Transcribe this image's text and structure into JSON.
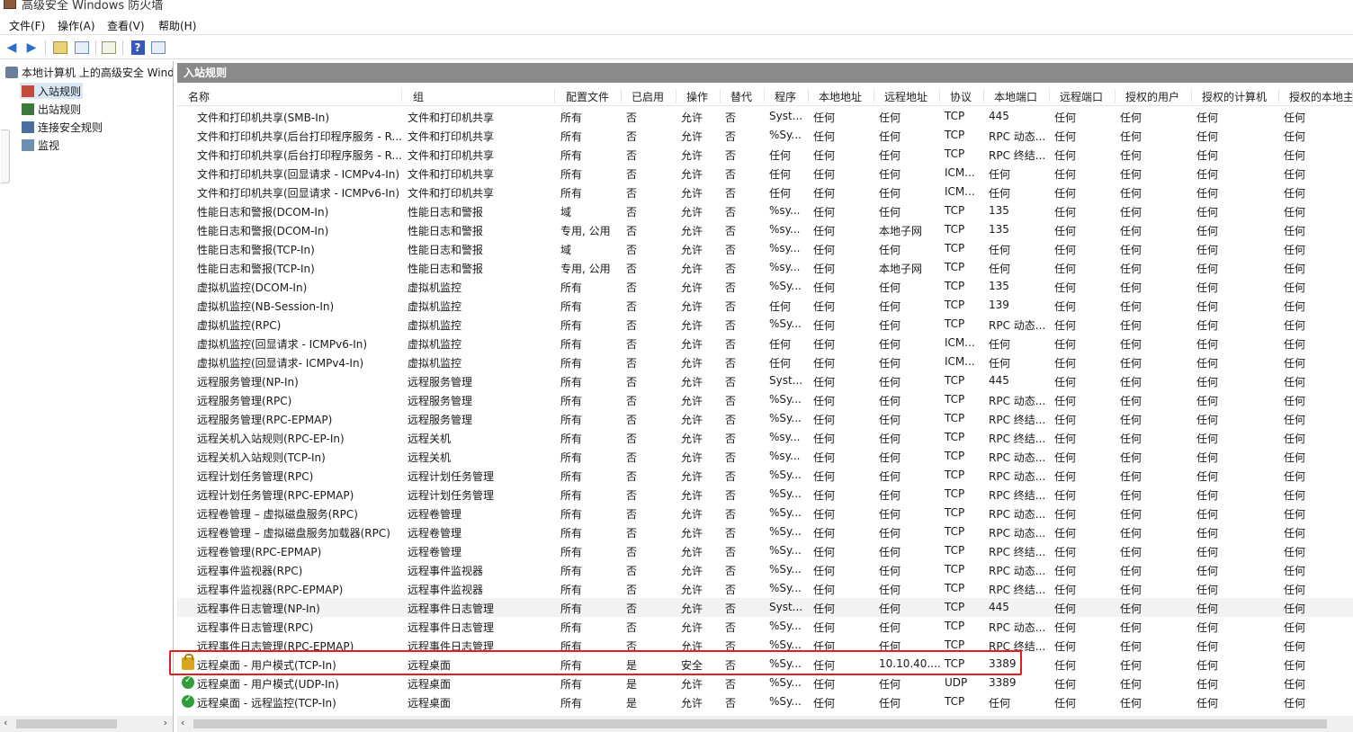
{
  "window": {
    "title": "高级安全 Windows 防火墙"
  },
  "menu": [
    "文件(F)",
    "操作(A)",
    "查看(V)",
    "帮助(H)"
  ],
  "toolbar": {
    "help_label": "?"
  },
  "tree": {
    "root": "本地计算机 上的高级安全 Windows 防火墙",
    "items": [
      "入站规则",
      "出站规则",
      "连接安全规则",
      "监视"
    ]
  },
  "pane": {
    "title": "入站规则"
  },
  "columns": [
    "名称",
    "组",
    "配置文件",
    "已启用",
    "操作",
    "替代",
    "程序",
    "本地地址",
    "远程地址",
    "协议",
    "本地端口",
    "远程端口",
    "授权的用户",
    "授权的计算机",
    "授权的本地主体"
  ],
  "rows": [
    {
      "status": "",
      "cells": [
        "文件和打印机共享(SMB-In)",
        "文件和打印机共享",
        "所有",
        "否",
        "允许",
        "否",
        "Syst...",
        "任何",
        "任何",
        "TCP",
        "445",
        "任何",
        "任何",
        "任何",
        "任何"
      ]
    },
    {
      "status": "",
      "cells": [
        "文件和打印机共享(后台打印程序服务 - R...",
        "文件和打印机共享",
        "所有",
        "否",
        "允许",
        "否",
        "%Sy...",
        "任何",
        "任何",
        "TCP",
        "RPC 动态...",
        "任何",
        "任何",
        "任何",
        "任何"
      ]
    },
    {
      "status": "",
      "cells": [
        "文件和打印机共享(后台打印程序服务 - R...",
        "文件和打印机共享",
        "所有",
        "否",
        "允许",
        "否",
        "任何",
        "任何",
        "任何",
        "TCP",
        "RPC 终结...",
        "任何",
        "任何",
        "任何",
        "任何"
      ]
    },
    {
      "status": "",
      "cells": [
        "文件和打印机共享(回显请求 - ICMPv4-In)",
        "文件和打印机共享",
        "所有",
        "否",
        "允许",
        "否",
        "任何",
        "任何",
        "任何",
        "ICM...",
        "任何",
        "任何",
        "任何",
        "任何",
        "任何"
      ]
    },
    {
      "status": "",
      "cells": [
        "文件和打印机共享(回显请求 - ICMPv6-In)",
        "文件和打印机共享",
        "所有",
        "否",
        "允许",
        "否",
        "任何",
        "任何",
        "任何",
        "ICM...",
        "任何",
        "任何",
        "任何",
        "任何",
        "任何"
      ]
    },
    {
      "status": "",
      "cells": [
        "性能日志和警报(DCOM-In)",
        "性能日志和警报",
        "域",
        "否",
        "允许",
        "否",
        "%sy...",
        "任何",
        "任何",
        "TCP",
        "135",
        "任何",
        "任何",
        "任何",
        "任何"
      ]
    },
    {
      "status": "",
      "cells": [
        "性能日志和警报(DCOM-In)",
        "性能日志和警报",
        "专用, 公用",
        "否",
        "允许",
        "否",
        "%sy...",
        "任何",
        "本地子网",
        "TCP",
        "135",
        "任何",
        "任何",
        "任何",
        "任何"
      ]
    },
    {
      "status": "",
      "cells": [
        "性能日志和警报(TCP-In)",
        "性能日志和警报",
        "域",
        "否",
        "允许",
        "否",
        "%sy...",
        "任何",
        "任何",
        "TCP",
        "任何",
        "任何",
        "任何",
        "任何",
        "任何"
      ]
    },
    {
      "status": "",
      "cells": [
        "性能日志和警报(TCP-In)",
        "性能日志和警报",
        "专用, 公用",
        "否",
        "允许",
        "否",
        "%sy...",
        "任何",
        "本地子网",
        "TCP",
        "任何",
        "任何",
        "任何",
        "任何",
        "任何"
      ]
    },
    {
      "status": "",
      "cells": [
        "虚拟机监控(DCOM-In)",
        "虚拟机监控",
        "所有",
        "否",
        "允许",
        "否",
        "%Sy...",
        "任何",
        "任何",
        "TCP",
        "135",
        "任何",
        "任何",
        "任何",
        "任何"
      ]
    },
    {
      "status": "",
      "cells": [
        "虚拟机监控(NB-Session-In)",
        "虚拟机监控",
        "所有",
        "否",
        "允许",
        "否",
        "任何",
        "任何",
        "任何",
        "TCP",
        "139",
        "任何",
        "任何",
        "任何",
        "任何"
      ]
    },
    {
      "status": "",
      "cells": [
        "虚拟机监控(RPC)",
        "虚拟机监控",
        "所有",
        "否",
        "允许",
        "否",
        "%Sy...",
        "任何",
        "任何",
        "TCP",
        "RPC 动态...",
        "任何",
        "任何",
        "任何",
        "任何"
      ]
    },
    {
      "status": "",
      "cells": [
        "虚拟机监控(回显请求 - ICMPv6-In)",
        "虚拟机监控",
        "所有",
        "否",
        "允许",
        "否",
        "任何",
        "任何",
        "任何",
        "ICM...",
        "任何",
        "任何",
        "任何",
        "任何",
        "任何"
      ]
    },
    {
      "status": "",
      "cells": [
        "虚拟机监控(回显请求- ICMPv4-In)",
        "虚拟机监控",
        "所有",
        "否",
        "允许",
        "否",
        "任何",
        "任何",
        "任何",
        "ICM...",
        "任何",
        "任何",
        "任何",
        "任何",
        "任何"
      ]
    },
    {
      "status": "",
      "cells": [
        "远程服务管理(NP-In)",
        "远程服务管理",
        "所有",
        "否",
        "允许",
        "否",
        "Syst...",
        "任何",
        "任何",
        "TCP",
        "445",
        "任何",
        "任何",
        "任何",
        "任何"
      ]
    },
    {
      "status": "",
      "cells": [
        "远程服务管理(RPC)",
        "远程服务管理",
        "所有",
        "否",
        "允许",
        "否",
        "%Sy...",
        "任何",
        "任何",
        "TCP",
        "RPC 动态...",
        "任何",
        "任何",
        "任何",
        "任何"
      ]
    },
    {
      "status": "",
      "cells": [
        "远程服务管理(RPC-EPMAP)",
        "远程服务管理",
        "所有",
        "否",
        "允许",
        "否",
        "%Sy...",
        "任何",
        "任何",
        "TCP",
        "RPC 终结...",
        "任何",
        "任何",
        "任何",
        "任何"
      ]
    },
    {
      "status": "",
      "cells": [
        "远程关机入站规则(RPC-EP-In)",
        "远程关机",
        "所有",
        "否",
        "允许",
        "否",
        "%sy...",
        "任何",
        "任何",
        "TCP",
        "RPC 终结...",
        "任何",
        "任何",
        "任何",
        "任何"
      ]
    },
    {
      "status": "",
      "cells": [
        "远程关机入站规则(TCP-In)",
        "远程关机",
        "所有",
        "否",
        "允许",
        "否",
        "%sy...",
        "任何",
        "任何",
        "TCP",
        "RPC 动态...",
        "任何",
        "任何",
        "任何",
        "任何"
      ]
    },
    {
      "status": "",
      "cells": [
        "远程计划任务管理(RPC)",
        "远程计划任务管理",
        "所有",
        "否",
        "允许",
        "否",
        "%Sy...",
        "任何",
        "任何",
        "TCP",
        "RPC 动态...",
        "任何",
        "任何",
        "任何",
        "任何"
      ]
    },
    {
      "status": "",
      "cells": [
        "远程计划任务管理(RPC-EPMAP)",
        "远程计划任务管理",
        "所有",
        "否",
        "允许",
        "否",
        "%Sy...",
        "任何",
        "任何",
        "TCP",
        "RPC 终结...",
        "任何",
        "任何",
        "任何",
        "任何"
      ]
    },
    {
      "status": "",
      "cells": [
        "远程卷管理 – 虚拟磁盘服务(RPC)",
        "远程卷管理",
        "所有",
        "否",
        "允许",
        "否",
        "%Sy...",
        "任何",
        "任何",
        "TCP",
        "RPC 动态...",
        "任何",
        "任何",
        "任何",
        "任何"
      ]
    },
    {
      "status": "",
      "cells": [
        "远程卷管理 – 虚拟磁盘服务加载器(RPC)",
        "远程卷管理",
        "所有",
        "否",
        "允许",
        "否",
        "%Sy...",
        "任何",
        "任何",
        "TCP",
        "RPC 动态...",
        "任何",
        "任何",
        "任何",
        "任何"
      ]
    },
    {
      "status": "",
      "cells": [
        "远程卷管理(RPC-EPMAP)",
        "远程卷管理",
        "所有",
        "否",
        "允许",
        "否",
        "%Sy...",
        "任何",
        "任何",
        "TCP",
        "RPC 终结...",
        "任何",
        "任何",
        "任何",
        "任何"
      ]
    },
    {
      "status": "",
      "cells": [
        "远程事件监视器(RPC)",
        "远程事件监视器",
        "所有",
        "否",
        "允许",
        "否",
        "%Sy...",
        "任何",
        "任何",
        "TCP",
        "RPC 动态...",
        "任何",
        "任何",
        "任何",
        "任何"
      ]
    },
    {
      "status": "",
      "cells": [
        "远程事件监视器(RPC-EPMAP)",
        "远程事件监视器",
        "所有",
        "否",
        "允许",
        "否",
        "%Sy...",
        "任何",
        "任何",
        "TCP",
        "RPC 终结...",
        "任何",
        "任何",
        "任何",
        "任何"
      ]
    },
    {
      "status": "",
      "cells": [
        "远程事件日志管理(NP-In)",
        "远程事件日志管理",
        "所有",
        "否",
        "允许",
        "否",
        "Syst...",
        "任何",
        "任何",
        "TCP",
        "445",
        "任何",
        "任何",
        "任何",
        "任何"
      ],
      "alt": true
    },
    {
      "status": "",
      "cells": [
        "远程事件日志管理(RPC)",
        "远程事件日志管理",
        "所有",
        "否",
        "允许",
        "否",
        "%Sy...",
        "任何",
        "任何",
        "TCP",
        "RPC 动态...",
        "任何",
        "任何",
        "任何",
        "任何"
      ]
    },
    {
      "status": "",
      "cells": [
        "远程事件日志管理(RPC-EPMAP)",
        "远程事件日志管理",
        "所有",
        "否",
        "允许",
        "否",
        "%Sy...",
        "任何",
        "任何",
        "TCP",
        "RPC 终结...",
        "任何",
        "任何",
        "任何",
        "任何"
      ]
    },
    {
      "status": "secure",
      "cells": [
        "远程桌面 - 用户模式(TCP-In)",
        "远程桌面",
        "所有",
        "是",
        "安全",
        "否",
        "%Sy...",
        "任何",
        "10.10.40....",
        "TCP",
        "3389",
        "任何",
        "任何",
        "任何",
        "任何"
      ]
    },
    {
      "status": "allow",
      "cells": [
        "远程桌面 - 用户模式(UDP-In)",
        "远程桌面",
        "所有",
        "是",
        "允许",
        "否",
        "%Sy...",
        "任何",
        "任何",
        "UDP",
        "3389",
        "任何",
        "任何",
        "任何",
        "任何"
      ]
    },
    {
      "status": "allow",
      "cells": [
        "远程桌面 - 远程监控(TCP-In)",
        "远程桌面",
        "所有",
        "是",
        "允许",
        "否",
        "%Sy...",
        "任何",
        "任何",
        "TCP",
        "任何",
        "任何",
        "任何",
        "任何",
        "任何"
      ]
    }
  ],
  "colors": {
    "header_bar": "#8a8a8a",
    "highlight": "#e02020",
    "selection": "#d9e7f7"
  }
}
